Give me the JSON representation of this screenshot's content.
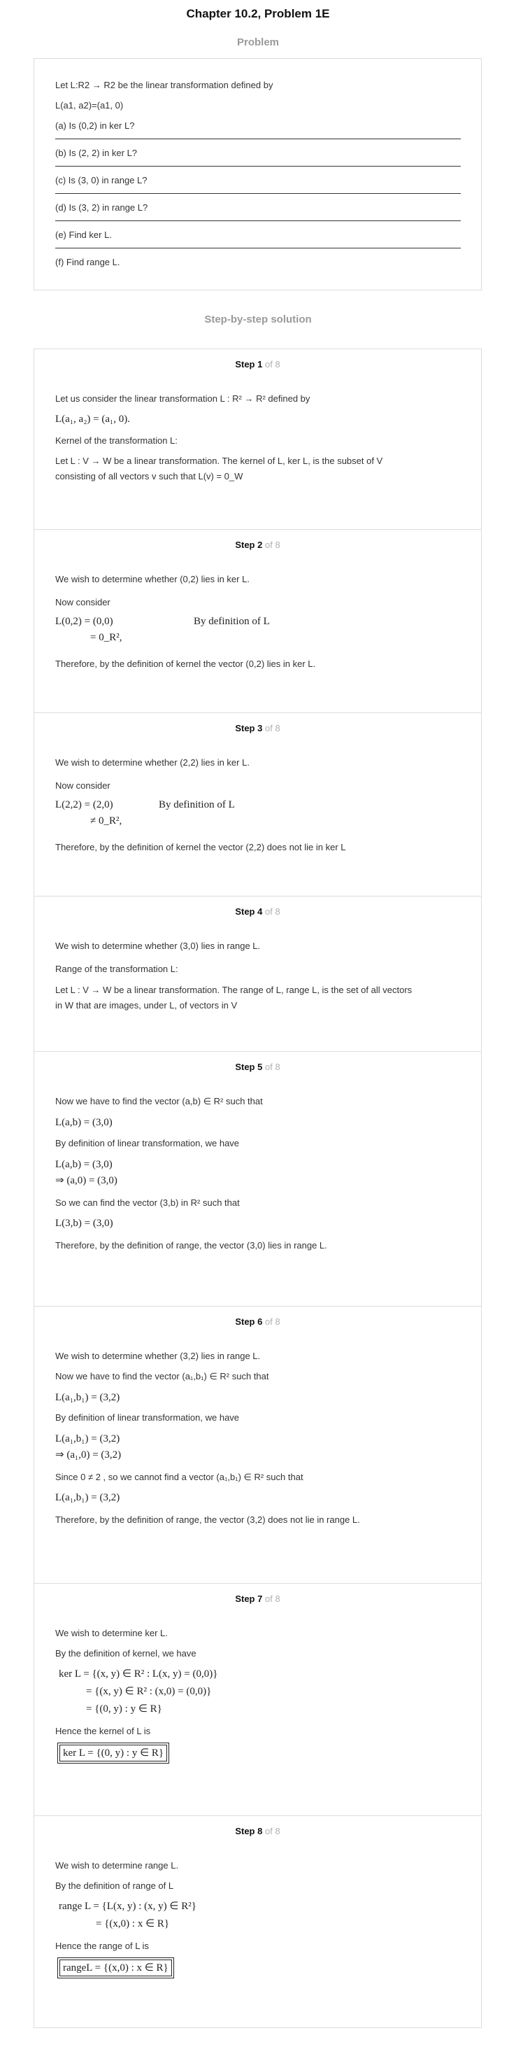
{
  "title": "Chapter 10.2, Problem 1E",
  "problem_heading": "Problem",
  "problem": {
    "lines": [
      "Let L:R2 → R2 be the linear transformation defined by",
      "L(a1, a2)=(a1, 0)",
      "(a) Is (0,2) in ker L?",
      "(b) Is (2, 2) in ker L?",
      "(c) Is (3, 0) in range L?",
      "(d) Is (3, 2) in range L?",
      "(e) Find ker L.",
      "(f) Find range L."
    ]
  },
  "solution_heading": "Step-by-step solution",
  "step_word": "Step",
  "of_text": "of 8",
  "steps": [
    {
      "num": "1",
      "lines": [
        "Let us consider the linear transformation  L : R² → R² defined by",
        "L(a₁, a₂) = (a₁, 0).",
        "Kernel of the transformation L:",
        "Let  L : V → W be a linear transformation. The kernel of L,  ker L, is the subset of V",
        "consisting of all vectors  v  such that  L(v) = 0_W"
      ]
    },
    {
      "num": "2",
      "lines": [
        "We wish to determine whether  (0,2) lies in  ker L.",
        "Now consider",
        "L(0,2) = (0,0)",
        "By definition of L",
        "= 0_R²,",
        "Therefore, by the definition of kernel the vector  (0,2) lies in  ker L."
      ]
    },
    {
      "num": "3",
      "lines": [
        "We wish to determine whether  (2,2) lies in  ker L.",
        "Now consider",
        "L(2,2) = (2,0)",
        "By definition of L",
        "≠ 0_R²,",
        "Therefore, by the definition of kernel the vector  (2,2) does not lie in  ker L"
      ]
    },
    {
      "num": "4",
      "lines": [
        "We wish to determine whether  (3,0)  lies in  range L.",
        "Range of the transformation  L:",
        "Let  L : V → W be a linear transformation. The range of L,  range L, is the set of all vectors",
        "in  W  that are images, under L, of vectors in  V"
      ]
    },
    {
      "num": "5",
      "lines": [
        "Now we have to find the vector  (a,b) ∈ R²  such that",
        "L(a,b) = (3,0)",
        "By definition of linear transformation, we have",
        "L(a,b) = (3,0)",
        "⇒ (a,0) = (3,0)",
        "So we can find the vector  (3,b) in  R² such that",
        "L(3,b) = (3,0)",
        "Therefore, by the definition of range, the vector  (3,0)  lies in range L."
      ]
    },
    {
      "num": "6",
      "lines": [
        "We wish to determine whether  (3,2)  lies in  range L.",
        "Now we have to find the vector  (a₁,b₁) ∈ R²  such that",
        "L(a₁,b₁) = (3,2)",
        "By definition of linear transformation, we have",
        "L(a₁,b₁) = (3,2)",
        "⇒ (a₁,0) = (3,2)",
        "Since  0 ≠ 2 , so we cannot find a vector  (a₁,b₁) ∈ R²  such that",
        "L(a₁,b₁) = (3,2)",
        "Therefore, by the definition of range, the vector  (3,2) does not lie in range L."
      ]
    },
    {
      "num": "7",
      "lines": [
        "We wish to determine  ker L.",
        "By the definition of kernel, we have",
        "ker L = {(x, y) ∈ R² : L(x, y) = (0,0)}",
        "= {(x, y) ∈ R² : (x,0) = (0,0)}",
        "= {(0, y) : y ∈ R}",
        "Hence the kernel of L is",
        "ker L = {(0, y) : y ∈ R}"
      ]
    },
    {
      "num": "8",
      "lines": [
        "We wish to determine  range L.",
        "By the definition of range of L",
        "range L = {L(x, y) : (x, y) ∈ R²}",
        "= {(x,0) : x ∈ R}",
        "Hence the range of L is",
        "rangeL = {(x,0) : x ∈ R}"
      ]
    }
  ]
}
